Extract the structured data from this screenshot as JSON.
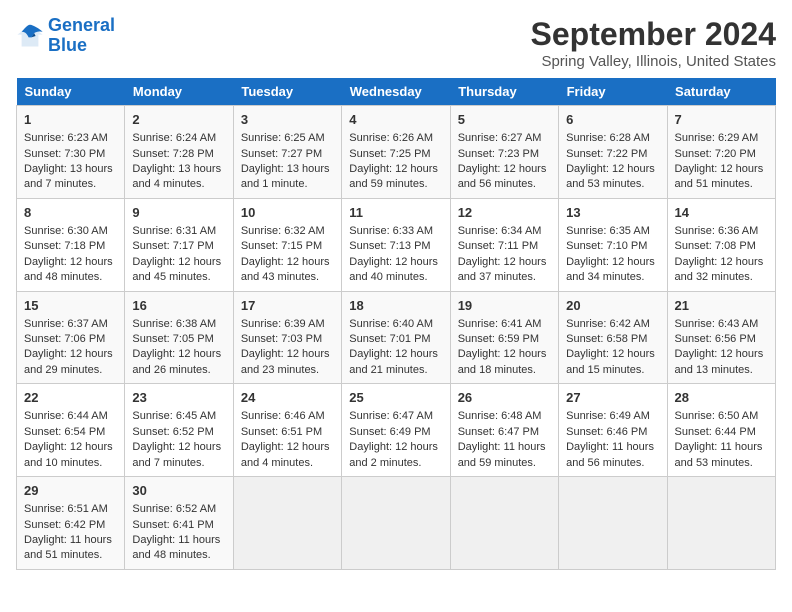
{
  "header": {
    "logo_line1": "General",
    "logo_line2": "Blue",
    "title": "September 2024",
    "subtitle": "Spring Valley, Illinois, United States"
  },
  "columns": [
    "Sunday",
    "Monday",
    "Tuesday",
    "Wednesday",
    "Thursday",
    "Friday",
    "Saturday"
  ],
  "weeks": [
    [
      {
        "day": "1",
        "rise": "Sunrise: 6:23 AM",
        "set": "Sunset: 7:30 PM",
        "daylight": "Daylight: 13 hours and 7 minutes."
      },
      {
        "day": "2",
        "rise": "Sunrise: 6:24 AM",
        "set": "Sunset: 7:28 PM",
        "daylight": "Daylight: 13 hours and 4 minutes."
      },
      {
        "day": "3",
        "rise": "Sunrise: 6:25 AM",
        "set": "Sunset: 7:27 PM",
        "daylight": "Daylight: 13 hours and 1 minute."
      },
      {
        "day": "4",
        "rise": "Sunrise: 6:26 AM",
        "set": "Sunset: 7:25 PM",
        "daylight": "Daylight: 12 hours and 59 minutes."
      },
      {
        "day": "5",
        "rise": "Sunrise: 6:27 AM",
        "set": "Sunset: 7:23 PM",
        "daylight": "Daylight: 12 hours and 56 minutes."
      },
      {
        "day": "6",
        "rise": "Sunrise: 6:28 AM",
        "set": "Sunset: 7:22 PM",
        "daylight": "Daylight: 12 hours and 53 minutes."
      },
      {
        "day": "7",
        "rise": "Sunrise: 6:29 AM",
        "set": "Sunset: 7:20 PM",
        "daylight": "Daylight: 12 hours and 51 minutes."
      }
    ],
    [
      {
        "day": "8",
        "rise": "Sunrise: 6:30 AM",
        "set": "Sunset: 7:18 PM",
        "daylight": "Daylight: 12 hours and 48 minutes."
      },
      {
        "day": "9",
        "rise": "Sunrise: 6:31 AM",
        "set": "Sunset: 7:17 PM",
        "daylight": "Daylight: 12 hours and 45 minutes."
      },
      {
        "day": "10",
        "rise": "Sunrise: 6:32 AM",
        "set": "Sunset: 7:15 PM",
        "daylight": "Daylight: 12 hours and 43 minutes."
      },
      {
        "day": "11",
        "rise": "Sunrise: 6:33 AM",
        "set": "Sunset: 7:13 PM",
        "daylight": "Daylight: 12 hours and 40 minutes."
      },
      {
        "day": "12",
        "rise": "Sunrise: 6:34 AM",
        "set": "Sunset: 7:11 PM",
        "daylight": "Daylight: 12 hours and 37 minutes."
      },
      {
        "day": "13",
        "rise": "Sunrise: 6:35 AM",
        "set": "Sunset: 7:10 PM",
        "daylight": "Daylight: 12 hours and 34 minutes."
      },
      {
        "day": "14",
        "rise": "Sunrise: 6:36 AM",
        "set": "Sunset: 7:08 PM",
        "daylight": "Daylight: 12 hours and 32 minutes."
      }
    ],
    [
      {
        "day": "15",
        "rise": "Sunrise: 6:37 AM",
        "set": "Sunset: 7:06 PM",
        "daylight": "Daylight: 12 hours and 29 minutes."
      },
      {
        "day": "16",
        "rise": "Sunrise: 6:38 AM",
        "set": "Sunset: 7:05 PM",
        "daylight": "Daylight: 12 hours and 26 minutes."
      },
      {
        "day": "17",
        "rise": "Sunrise: 6:39 AM",
        "set": "Sunset: 7:03 PM",
        "daylight": "Daylight: 12 hours and 23 minutes."
      },
      {
        "day": "18",
        "rise": "Sunrise: 6:40 AM",
        "set": "Sunset: 7:01 PM",
        "daylight": "Daylight: 12 hours and 21 minutes."
      },
      {
        "day": "19",
        "rise": "Sunrise: 6:41 AM",
        "set": "Sunset: 6:59 PM",
        "daylight": "Daylight: 12 hours and 18 minutes."
      },
      {
        "day": "20",
        "rise": "Sunrise: 6:42 AM",
        "set": "Sunset: 6:58 PM",
        "daylight": "Daylight: 12 hours and 15 minutes."
      },
      {
        "day": "21",
        "rise": "Sunrise: 6:43 AM",
        "set": "Sunset: 6:56 PM",
        "daylight": "Daylight: 12 hours and 13 minutes."
      }
    ],
    [
      {
        "day": "22",
        "rise": "Sunrise: 6:44 AM",
        "set": "Sunset: 6:54 PM",
        "daylight": "Daylight: 12 hours and 10 minutes."
      },
      {
        "day": "23",
        "rise": "Sunrise: 6:45 AM",
        "set": "Sunset: 6:52 PM",
        "daylight": "Daylight: 12 hours and 7 minutes."
      },
      {
        "day": "24",
        "rise": "Sunrise: 6:46 AM",
        "set": "Sunset: 6:51 PM",
        "daylight": "Daylight: 12 hours and 4 minutes."
      },
      {
        "day": "25",
        "rise": "Sunrise: 6:47 AM",
        "set": "Sunset: 6:49 PM",
        "daylight": "Daylight: 12 hours and 2 minutes."
      },
      {
        "day": "26",
        "rise": "Sunrise: 6:48 AM",
        "set": "Sunset: 6:47 PM",
        "daylight": "Daylight: 11 hours and 59 minutes."
      },
      {
        "day": "27",
        "rise": "Sunrise: 6:49 AM",
        "set": "Sunset: 6:46 PM",
        "daylight": "Daylight: 11 hours and 56 minutes."
      },
      {
        "day": "28",
        "rise": "Sunrise: 6:50 AM",
        "set": "Sunset: 6:44 PM",
        "daylight": "Daylight: 11 hours and 53 minutes."
      }
    ],
    [
      {
        "day": "29",
        "rise": "Sunrise: 6:51 AM",
        "set": "Sunset: 6:42 PM",
        "daylight": "Daylight: 11 hours and 51 minutes."
      },
      {
        "day": "30",
        "rise": "Sunrise: 6:52 AM",
        "set": "Sunset: 6:41 PM",
        "daylight": "Daylight: 11 hours and 48 minutes."
      },
      null,
      null,
      null,
      null,
      null
    ]
  ]
}
